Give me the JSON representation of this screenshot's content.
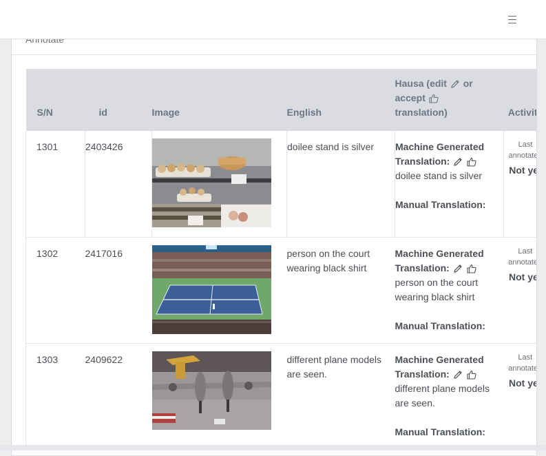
{
  "card": {
    "title": "Annotate"
  },
  "table": {
    "headers": {
      "sn": "S/N",
      "id": "id",
      "image": "Image",
      "english": "English",
      "hausa_line1": "Hausa (edit",
      "hausa_line2_a": "or",
      "hausa_line2_b": "accept",
      "hausa_line3": "translation)",
      "activity": "Activity"
    },
    "labels": {
      "mgt": "Machine Generated Translation:",
      "manual": "Manual Translation:",
      "last_annotated": "Last annotated",
      "not_yet": "Not yet"
    },
    "rows": [
      {
        "sn": "1301",
        "id": "2403426",
        "english": "doilee stand is silver",
        "machine": "doilee stand is silver",
        "image_icon": "bakery-display-photo"
      },
      {
        "sn": "1302",
        "id": "2417016",
        "english": "person on the court wearing black shirt",
        "machine": "person on the court wearing black shirt",
        "image_icon": "tennis-court-photo"
      },
      {
        "sn": "1303",
        "id": "2409622",
        "english": "different plane models are seen.",
        "machine": "different plane models are seen.",
        "image_icon": "airplane-hangar-photo"
      }
    ]
  }
}
